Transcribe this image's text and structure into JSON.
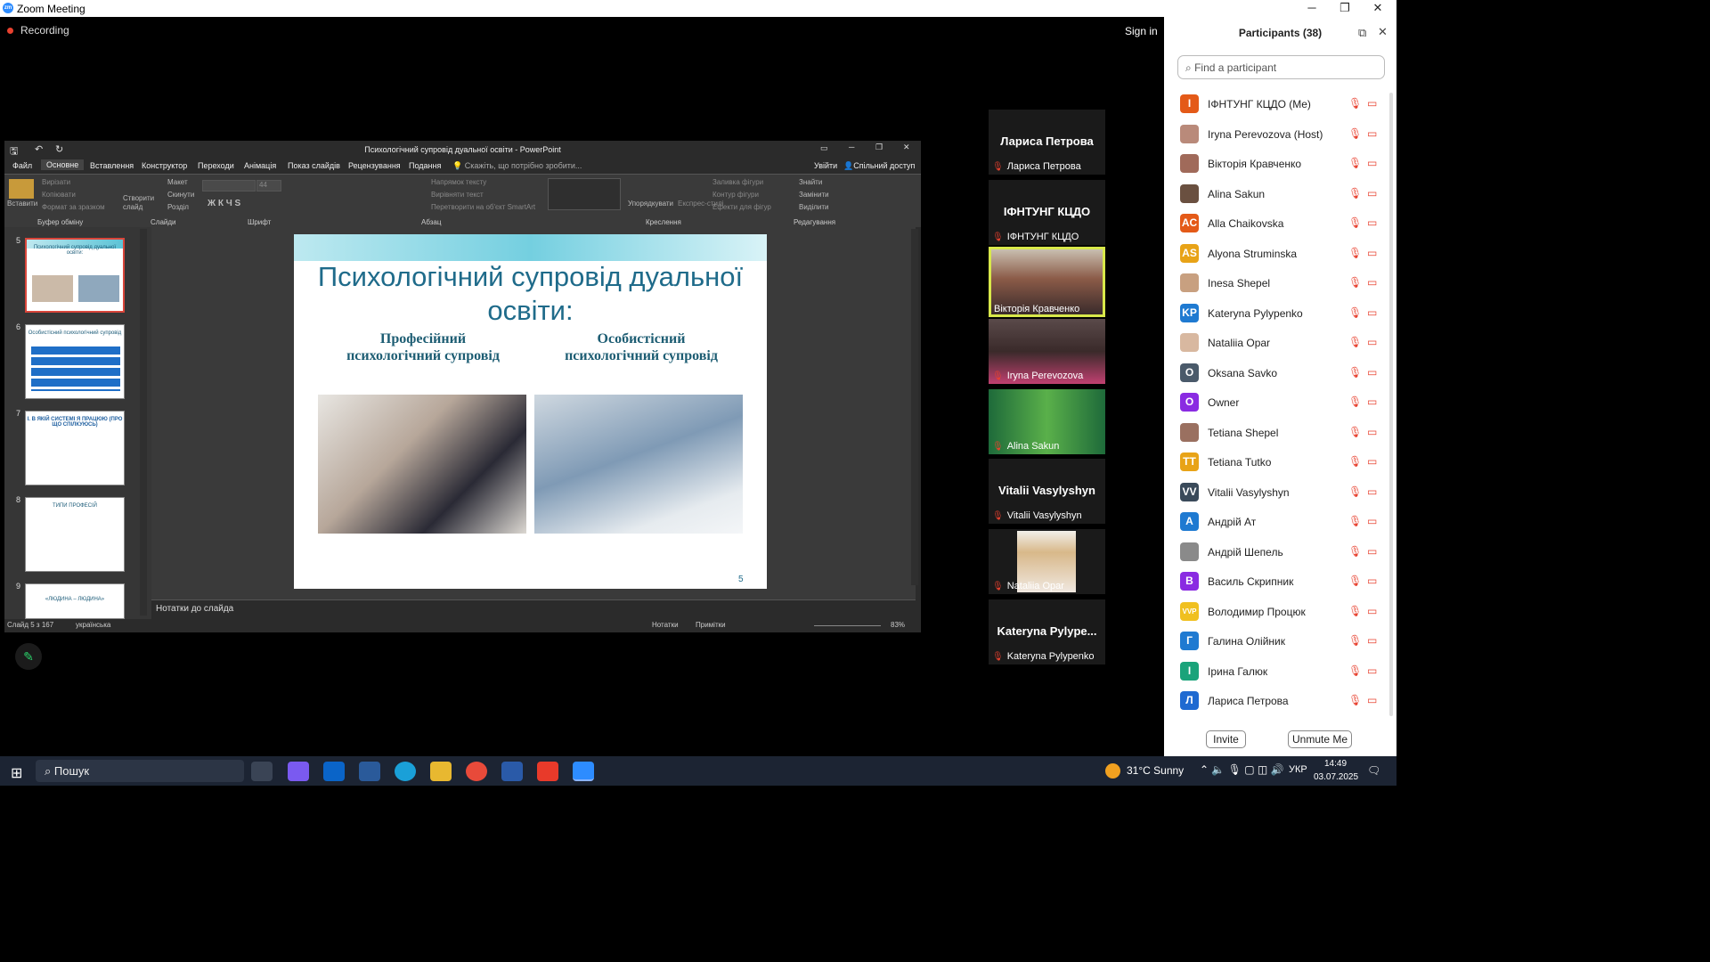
{
  "window": {
    "title": "Zoom Meeting",
    "logo": "zm"
  },
  "stage": {
    "recording": "Recording",
    "signin": "Sign in"
  },
  "ppt": {
    "title": "Психологічний супровід дуальної освіти - PowerPoint",
    "menu": [
      "Файл",
      "Основне",
      "Вставлення",
      "Конструктор",
      "Переходи",
      "Анімація",
      "Показ слайдів",
      "Рецензування",
      "Подання"
    ],
    "tellme": "Скажіть, що потрібно зробити...",
    "signin": "Увійти",
    "share": "Спільний доступ",
    "groups": {
      "clip": "Буфер обміну",
      "slides": "Слайди",
      "font": "Шрифт",
      "para": "Абзац",
      "draw": "Креслення",
      "edit": "Редагування"
    },
    "ribbon": {
      "paste": "Вставити",
      "cut": "Вирізати",
      "copy": "Копіювати",
      "format": "Формат за зразком",
      "new": "Створити слайд",
      "layout": "Макет",
      "reset": "Скинути",
      "section": "Розділ",
      "fontsize": "44",
      "textdir": "Напрямок тексту",
      "align": "Вирівняти текст",
      "smartart": "Перетворити на об'єкт SmartArt",
      "arrange": "Упорядкувати",
      "styles": "Експрес-стилі",
      "fill": "Заливка фігури",
      "outline": "Контур фігури",
      "effects": "Ефекти для фігур",
      "find": "Знайти",
      "replace": "Замінити",
      "select": "Виділити"
    },
    "thumbs": [
      {
        "n": "5",
        "title": "Психологічний супровід дуальної освіти:"
      },
      {
        "n": "6",
        "title": "Особистісний психологічний супровід"
      },
      {
        "n": "7",
        "title": "І. В ЯКІЙ СИСТЕМІ Я ПРАЦЮЮ (ПРО ЩО СПІЛКУЮСЬ)"
      },
      {
        "n": "8",
        "title": "ТИПИ ПРОФЕСІЙ"
      },
      {
        "n": "9",
        "title": "«ЛЮДИНА – ЛЮДИНА»"
      }
    ],
    "slide": {
      "title1": "Психологічний супровід дуальної",
      "title2": "освіти:",
      "left1": "Професійний",
      "left2": "психологічний супровід",
      "right1": "Особистісний",
      "right2": "психологічний супровід",
      "page": "5"
    },
    "notes": "Нотатки до слайда",
    "status": {
      "slide": "Слайд 5 з 167",
      "lang": "українська",
      "notes": "Нотатки",
      "comments": "Примітки",
      "zoom": "83%"
    }
  },
  "gallery": [
    {
      "big": "Лариса Петрова",
      "name": "Лариса Петрова"
    },
    {
      "big": "ІФНТУНГ КЦДО",
      "name": "ІФНТУНГ КЦДО"
    },
    {
      "name": "Вікторія Кравченко"
    },
    {
      "name": "Iryna Perevozova"
    },
    {
      "name": "Alina Sakun"
    },
    {
      "big": "Vitalii Vasylyshyn",
      "name": "Vitalii Vasylyshyn"
    },
    {
      "name": "Nataliia Opar"
    },
    {
      "big": "Kateryna Pylype...",
      "name": "Kateryna Pylypenko"
    }
  ],
  "participants": {
    "title": "Participants (38)",
    "search": "Find a participant",
    "list": [
      {
        "i": "І",
        "name": "ІФНТУНГ КЦДО (Me)",
        "c": "#e45a18"
      },
      {
        "i": "",
        "name": "Iryna Perevozova (Host)",
        "c": "#b98a7a"
      },
      {
        "i": "",
        "name": "Вікторія Кравченко",
        "c": "#a06a5a"
      },
      {
        "i": "",
        "name": "Alina Sakun",
        "c": "#6a5040"
      },
      {
        "i": "AC",
        "name": "Alla Chaikovska",
        "c": "#e45a18"
      },
      {
        "i": "AS",
        "name": "Alyona Struminska",
        "c": "#e8a317"
      },
      {
        "i": "",
        "name": "Inesa Shepel",
        "c": "#c8a080"
      },
      {
        "i": "KP",
        "name": "Kateryna Pylypenko",
        "c": "#1f7ad1"
      },
      {
        "i": "",
        "name": "Nataliia Opar",
        "c": "#d8b8a0"
      },
      {
        "i": "O",
        "name": "Oksana Savko",
        "c": "#4a5a6a"
      },
      {
        "i": "O",
        "name": "Owner",
        "c": "#8a2be2"
      },
      {
        "i": "",
        "name": "Tetiana Shepel",
        "c": "#9a7060"
      },
      {
        "i": "TT",
        "name": "Tetiana Tutko",
        "c": "#e8a317"
      },
      {
        "i": "VV",
        "name": "Vitalii Vasylyshyn",
        "c": "#3a4a5a"
      },
      {
        "i": "А",
        "name": "Андрій Ат",
        "c": "#1f7ad1"
      },
      {
        "i": "",
        "name": "Андрій Шепель",
        "c": "#8a8a8a"
      },
      {
        "i": "В",
        "name": "Василь Скрипник",
        "c": "#8a2be2"
      },
      {
        "i": "VVP",
        "name": "Володимир Процюк",
        "c": "#f0c020"
      },
      {
        "i": "Г",
        "name": "Галина Олійник",
        "c": "#1f7ad1"
      },
      {
        "i": "І",
        "name": "Ірина Галюк",
        "c": "#1aa37a"
      },
      {
        "i": "Л",
        "name": "Лариса Петрова",
        "c": "#1f6ad1"
      }
    ],
    "invite": "Invite",
    "unmute": "Unmute Me"
  },
  "taskbar": {
    "search": "Пошук",
    "weather": "31°C Sunny",
    "lang": "УКР",
    "time": "14:49",
    "date": "03.07.2025"
  }
}
